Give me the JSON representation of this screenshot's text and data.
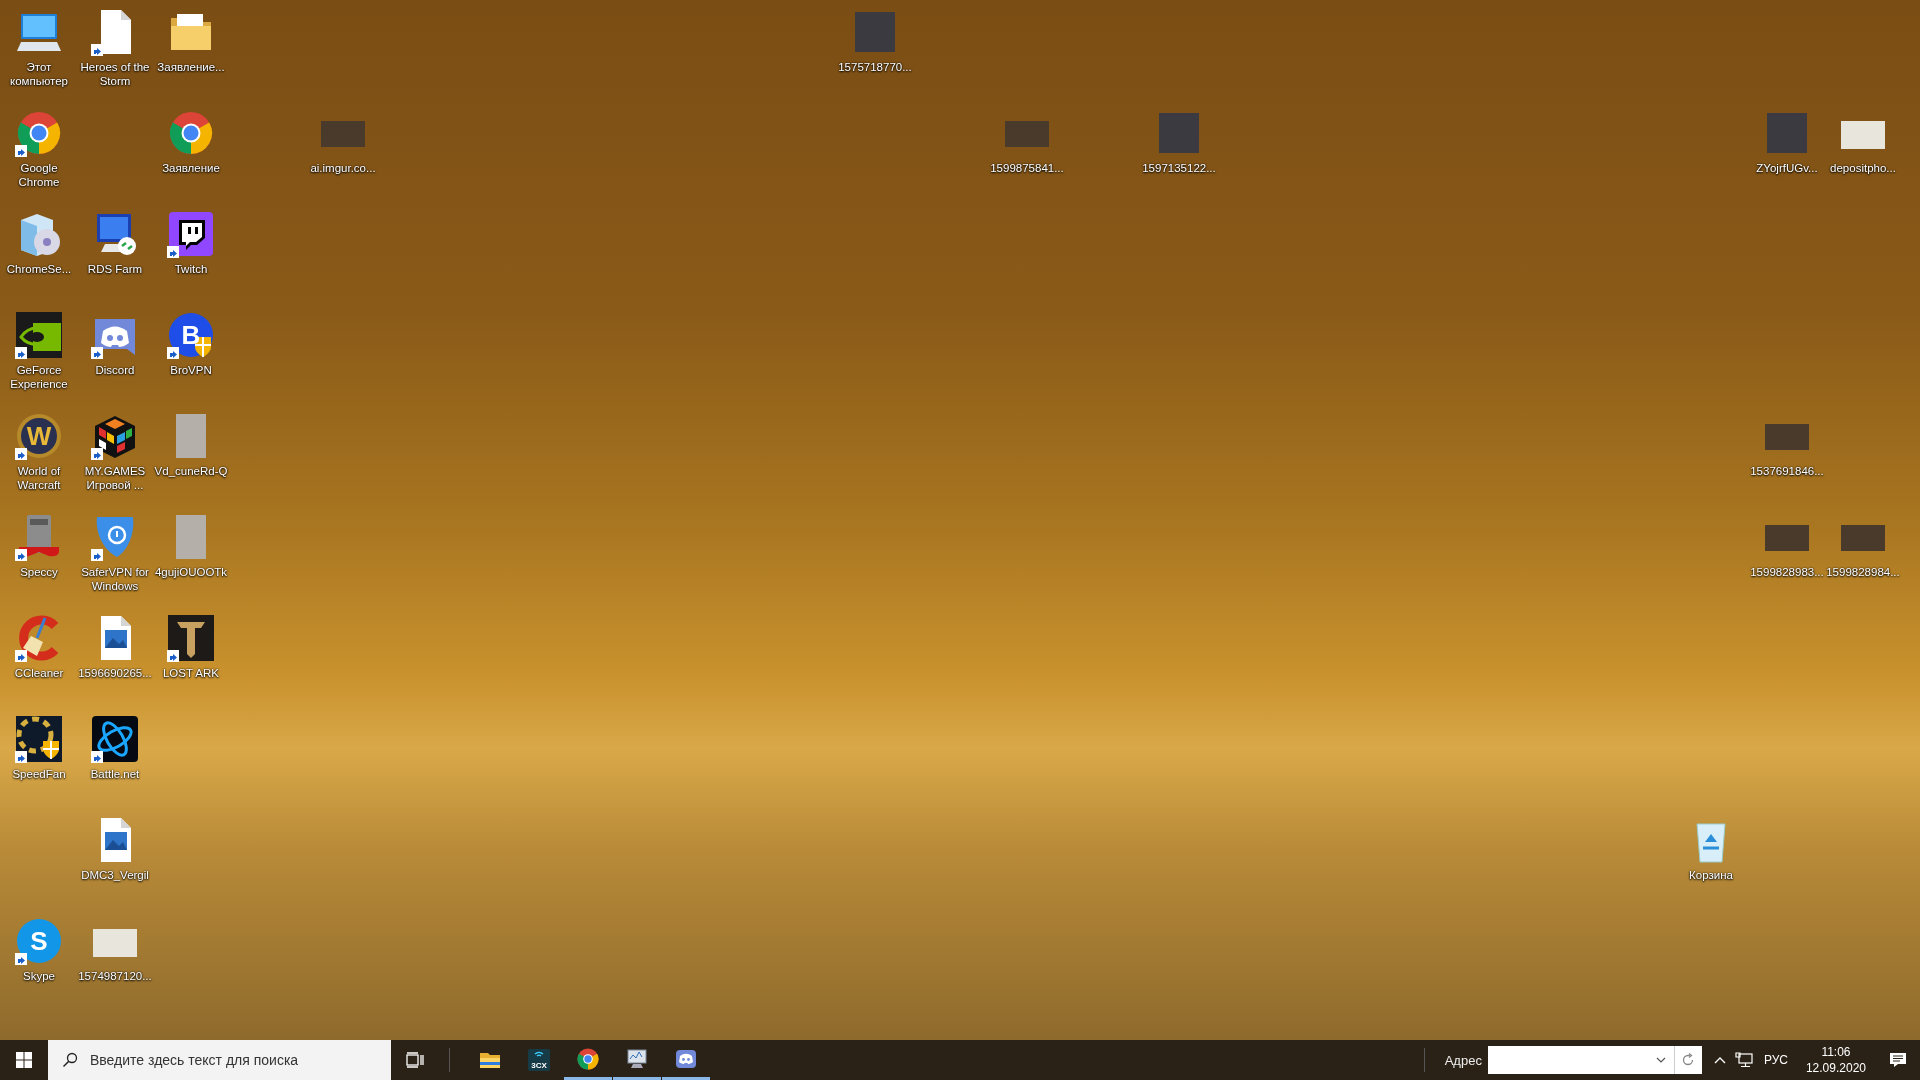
{
  "desktop": {
    "icons": [
      {
        "label": "Этот компьютер",
        "kind": "computer",
        "shortcut": false
      },
      {
        "label": "Heroes of the Storm",
        "kind": "document",
        "shortcut": true
      },
      {
        "label": "Заявление...",
        "kind": "folder",
        "shortcut": false
      },
      {
        "label": "1575718770...",
        "kind": "photo",
        "shortcut": false
      },
      {
        "label": "Google Chrome",
        "kind": "chrome",
        "shortcut": true
      },
      {
        "label": "Заявление",
        "kind": "chrome",
        "shortcut": false
      },
      {
        "label": "ai.imgur.co...",
        "kind": "photo-wide",
        "shortcut": false
      },
      {
        "label": "1599875841...",
        "kind": "photo-wide",
        "shortcut": false
      },
      {
        "label": "1597135122...",
        "kind": "photo",
        "shortcut": false
      },
      {
        "label": "ZYojrfUGv...",
        "kind": "photo",
        "shortcut": false
      },
      {
        "label": "depositpho...",
        "kind": "photo-light",
        "shortcut": false
      },
      {
        "label": "ChromeSe...",
        "kind": "setup",
        "shortcut": false
      },
      {
        "label": "RDS Farm",
        "kind": "remote",
        "shortcut": false
      },
      {
        "label": "Twitch",
        "kind": "twitch",
        "shortcut": true
      },
      {
        "label": "GeForce Experience",
        "kind": "nvidia",
        "shortcut": true
      },
      {
        "label": "Discord",
        "kind": "discord",
        "shortcut": true
      },
      {
        "label": "BroVPN",
        "kind": "letter-vpn",
        "shortcut": true,
        "logo_text": "B"
      },
      {
        "label": "World of Warcraft",
        "kind": "emblem",
        "shortcut": true,
        "logo_text": "W"
      },
      {
        "label": "MY.GAMES Игровой ...",
        "kind": "cube",
        "shortcut": true
      },
      {
        "label": "Vd_cuneRd-Q",
        "kind": "scan",
        "shortcut": false
      },
      {
        "label": "1537691846...",
        "kind": "photo-wide",
        "shortcut": false
      },
      {
        "label": "Speccy",
        "kind": "speccy",
        "shortcut": true
      },
      {
        "label": "SaferVPN for Windows",
        "kind": "shield",
        "shortcut": true
      },
      {
        "label": "4gujiOUOOTk",
        "kind": "scan",
        "shortcut": false
      },
      {
        "label": "1599828983...",
        "kind": "photo-wide",
        "shortcut": false
      },
      {
        "label": "1599828984...",
        "kind": "photo-wide",
        "shortcut": false
      },
      {
        "label": "CCleaner",
        "kind": "ccleaner",
        "shortcut": true
      },
      {
        "label": "1596690265...",
        "kind": "image-file",
        "shortcut": false
      },
      {
        "label": "LOST ARK",
        "kind": "lostark",
        "shortcut": true
      },
      {
        "label": "SpeedFan",
        "kind": "fan",
        "shortcut": true
      },
      {
        "label": "Battle.net",
        "kind": "battlenet",
        "shortcut": true
      },
      {
        "label": "DMC3_Vergil",
        "kind": "image-file",
        "shortcut": false
      },
      {
        "label": "Корзина",
        "kind": "recycle-bin",
        "shortcut": false
      },
      {
        "label": "Skype",
        "kind": "letter-chat",
        "shortcut": true,
        "logo_text": "S"
      },
      {
        "label": "1574987120...",
        "kind": "photo-light",
        "shortcut": false
      }
    ]
  },
  "taskbar": {
    "search": {
      "placeholder": "Введите здесь текст для поиска"
    },
    "apps": [
      {
        "kind": "folder",
        "running": false
      },
      {
        "kind": "softphone",
        "running": false,
        "logo_text": "3CX"
      },
      {
        "kind": "chrome",
        "running": true
      },
      {
        "kind": "monitor",
        "running": true
      },
      {
        "kind": "discord",
        "running": true
      }
    ],
    "address_toolbar": {
      "label": "Адрес"
    },
    "language": "РУС",
    "time": "11:06",
    "date": "12.09.2020"
  }
}
